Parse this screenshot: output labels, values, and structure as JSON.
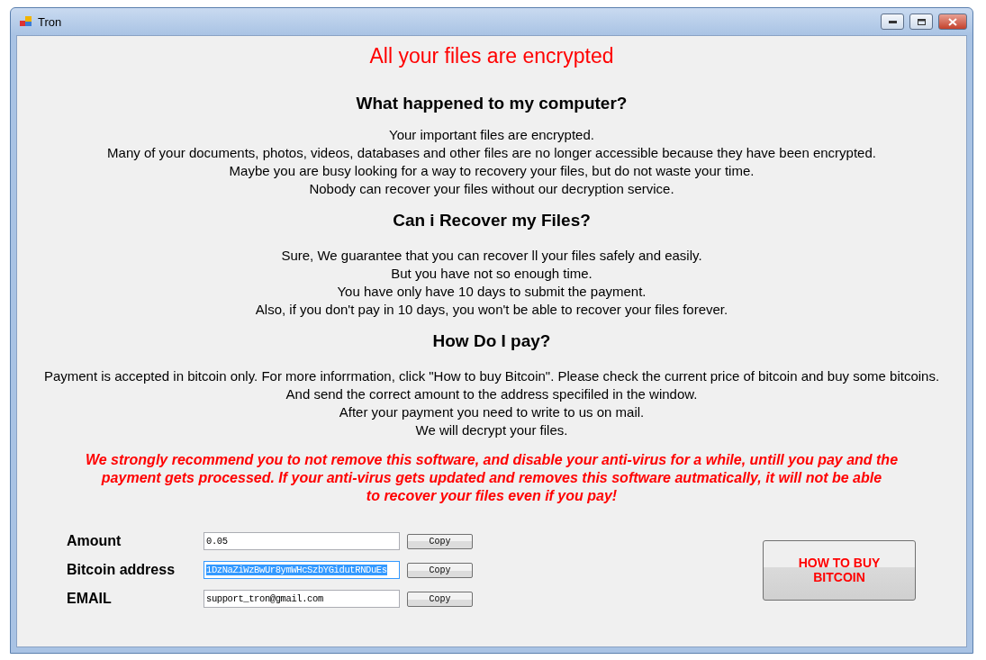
{
  "window": {
    "title": "Tron"
  },
  "headline": "All your files are encrypted",
  "sections": [
    {
      "heading": "What happened to my computer?",
      "lines": [
        "Your important files are encrypted.",
        "Many of your documents, photos, videos, databases and other files are no longer accessible because they have been encrypted.",
        "Maybe you are busy looking for a way to recovery your files, but do not waste your time.",
        "Nobody can recover your files without our decryption service."
      ]
    },
    {
      "heading": "Can i Recover my Files?",
      "lines": [
        "Sure, We guarantee that you can recover ll your files safely and easily.",
        "But you have not so enough time.",
        "You have only have 10 days to submit the payment.",
        "Also, if you don't pay in 10 days, you won't be able to recover your files forever."
      ]
    },
    {
      "heading": "How Do I pay?",
      "lines": [
        "Payment is accepted in bitcoin only. For more inforrmation, click \"How to buy Bitcoin\". Please check the current price of bitcoin and buy some bitcoins.",
        "And send the correct amount to the address specifiled in the window.",
        "After your payment you need to write to us on mail.",
        "We will decrypt your files."
      ]
    }
  ],
  "warning": [
    "We strongly recommend you to not remove this software, and disable your anti-virus for a while, untill you pay and the",
    "payment gets processed. If your anti-virus gets updated and removes this software autmatically, it will not be able",
    "to recover your files even if you pay!"
  ],
  "fields": [
    {
      "label": "Amount",
      "value": "0.05",
      "button": "Copy",
      "selected": false
    },
    {
      "label": "Bitcoin address",
      "value": "1DzNaZiWzBwUr8ymWHcSzbYGidutRNDuEs",
      "button": "Copy",
      "selected": true
    },
    {
      "label": "EMAIL",
      "value": "support_tron@gmail.com",
      "button": "Copy",
      "selected": false
    }
  ],
  "buy_button": "HOW TO BUY\nBITCOIN"
}
